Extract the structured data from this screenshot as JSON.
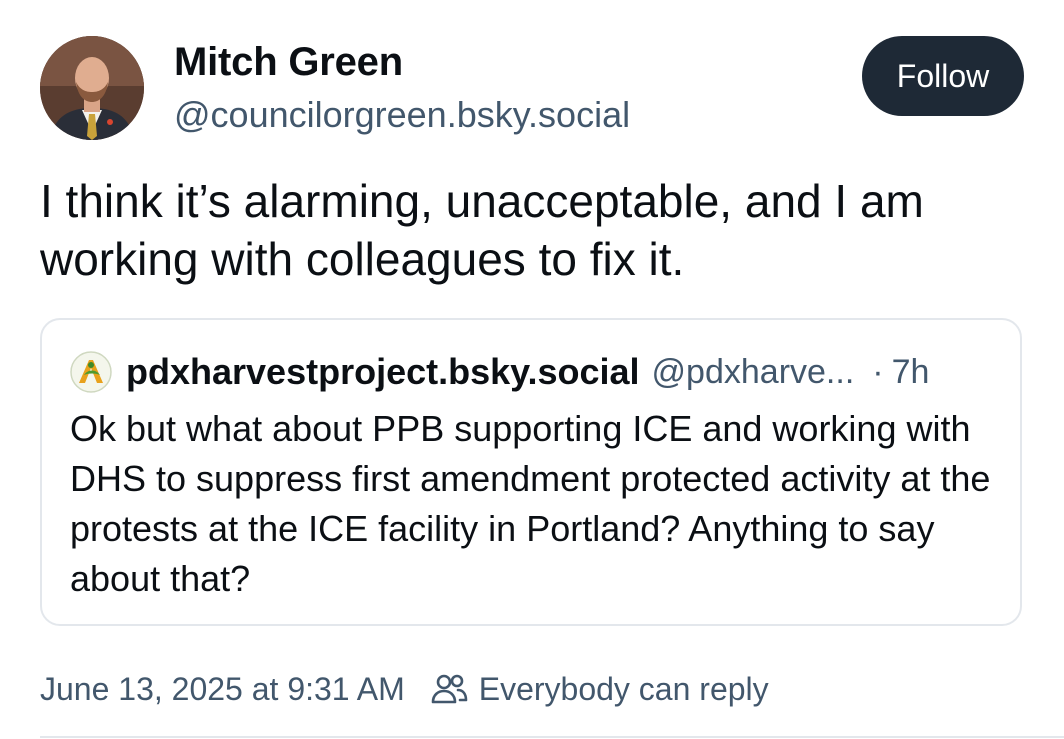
{
  "author": {
    "name": "Mitch Green",
    "handle": "@councilorgreen.bsky.social"
  },
  "follow_label": "Follow",
  "post": {
    "text": "I think it’s alarming, unacceptable, and I am working with colleagues to fix it."
  },
  "quote": {
    "name": "pdxharvestproject.bsky.social",
    "handle": "@pdxharve...",
    "separator": "·",
    "time": "7h",
    "text": "Ok but what about PPB supporting ICE and working with DHS to suppress first amendment protected activity at the protests at the ICE facility in Portland? Anything to say about that?"
  },
  "meta": {
    "timestamp": "June 13, 2025 at 9:31 AM",
    "reply_setting": "Everybody can reply"
  },
  "icons": {
    "avatar": "profile-photo",
    "quote_avatar": "harvest-logo",
    "reply_setting": "people-icon"
  },
  "colors": {
    "follow_bg": "#1e2936",
    "secondary_text": "#42576c",
    "border": "#e3e7ec"
  }
}
